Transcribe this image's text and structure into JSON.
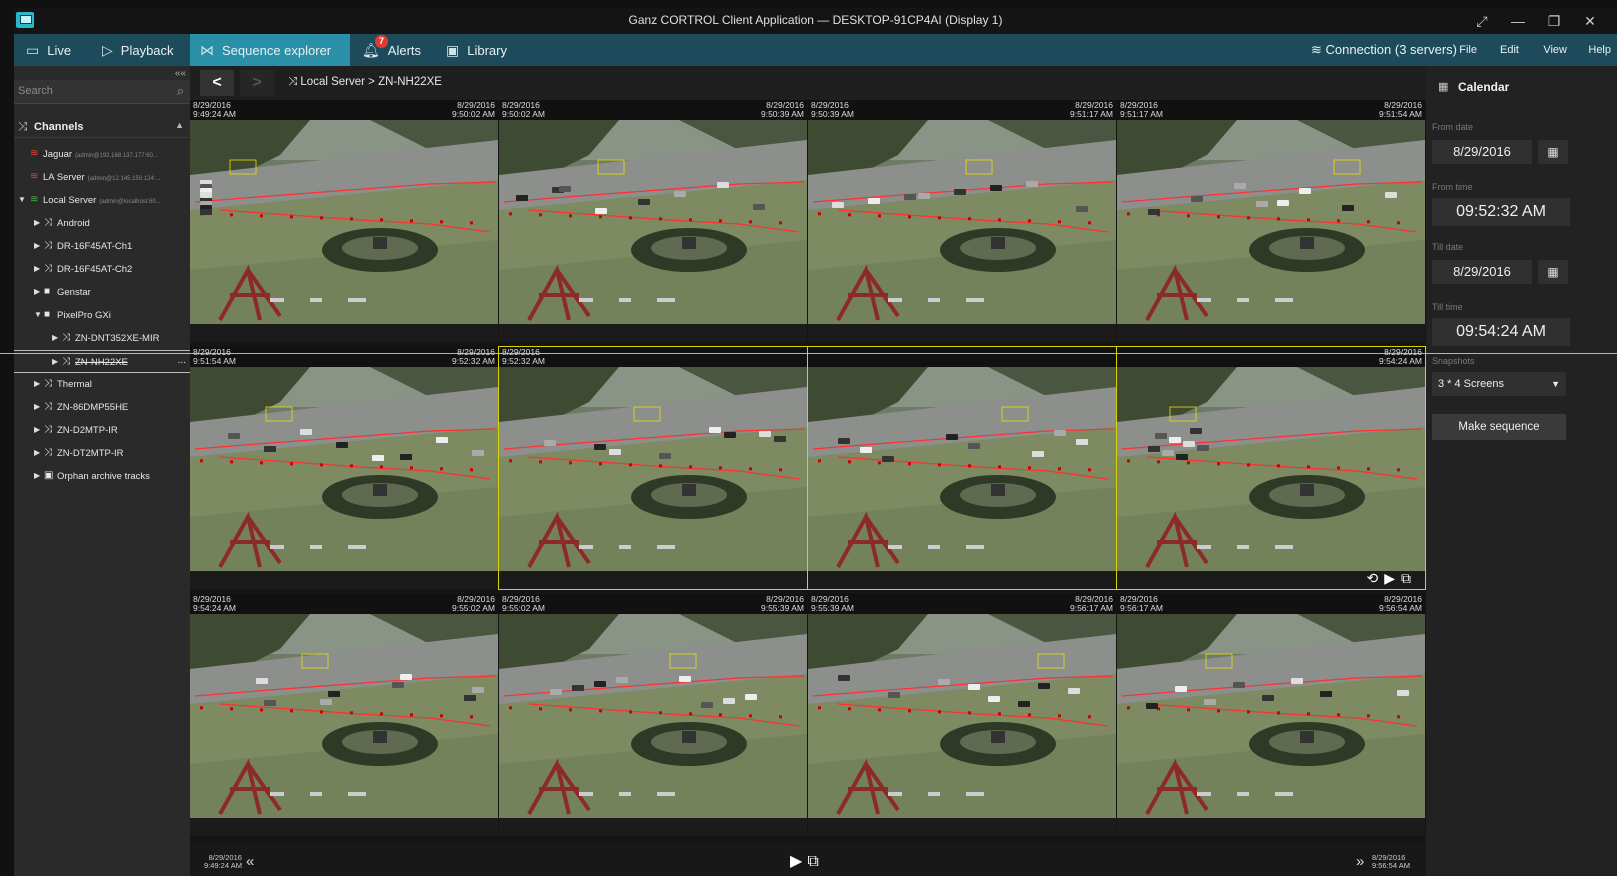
{
  "window": {
    "title": "Ganz CORTROL Client Application — DESKTOP-91CP4AI (Display 1)",
    "controls": [
      "⤢",
      "—",
      "❐",
      "✕"
    ]
  },
  "menu": {
    "tabs": [
      {
        "label": "Live",
        "icon": "monitor-icon"
      },
      {
        "label": "Playback",
        "icon": "play-outline-icon"
      },
      {
        "label": "Sequence explorer",
        "icon": "sequence-icon"
      },
      {
        "label": "Alerts",
        "icon": "bell-icon",
        "badge": "7"
      },
      {
        "label": "Library",
        "icon": "library-icon"
      }
    ],
    "connection": "Connection (3 servers)",
    "right_items": [
      "File",
      "Edit",
      "View",
      "Help"
    ]
  },
  "sidebar": {
    "collapse_glyph": "««",
    "search_placeholder": "Search",
    "channels_label": "Channels",
    "tree": [
      {
        "label": "Jaguar",
        "sub": "(admin@192.168.137.177:60...",
        "level": 0,
        "icon": "server-red-icon",
        "arrow": ""
      },
      {
        "label": "LA Server",
        "sub": "(admin@12.145.150.124:...",
        "level": 0,
        "icon": "server-red-icon",
        "arrow": ""
      },
      {
        "label": "Local Server",
        "sub": "(admin@localhost:60...",
        "level": 0,
        "icon": "server-green-icon",
        "arrow": "▼"
      },
      {
        "label": "Android",
        "sub": "",
        "level": 1,
        "icon": "channel-icon",
        "arrow": "▶"
      },
      {
        "label": "DR-16F45AT-Ch1",
        "sub": "",
        "level": 1,
        "icon": "channel-icon",
        "arrow": "▶"
      },
      {
        "label": "DR-16F45AT-Ch2",
        "sub": "",
        "level": 1,
        "icon": "channel-icon",
        "arrow": "▶"
      },
      {
        "label": "Genstar",
        "sub": "",
        "level": 1,
        "icon": "folder-icon",
        "arrow": "▶"
      },
      {
        "label": "PixelPro GXi",
        "sub": "",
        "level": 1,
        "icon": "folder-icon",
        "arrow": "▼"
      },
      {
        "label": "ZN-DNT352XE-MIR",
        "sub": "",
        "level": 2,
        "icon": "channel-icon",
        "arrow": "▶"
      },
      {
        "label": "ZN-NH22XE",
        "sub": "",
        "level": 2,
        "icon": "channel-icon",
        "arrow": "▶",
        "selected": true,
        "more": "..."
      },
      {
        "label": "Thermal",
        "sub": "",
        "level": 1,
        "icon": "channel-icon",
        "arrow": "▶"
      },
      {
        "label": "ZN-86DMP55HE",
        "sub": "",
        "level": 1,
        "icon": "channel-icon",
        "arrow": "▶"
      },
      {
        "label": "ZN-D2MTP-IR",
        "sub": "",
        "level": 1,
        "icon": "channel-icon",
        "arrow": "▶"
      },
      {
        "label": "ZN-DT2MTP-IR",
        "sub": "",
        "level": 1,
        "icon": "channel-icon",
        "arrow": "▶"
      },
      {
        "label": "Orphan archive tracks",
        "sub": "",
        "level": 1,
        "icon": "archive-icon",
        "arrow": "▶"
      }
    ]
  },
  "nav": {
    "back": "<",
    "forward": ">",
    "breadcrumb": "Local Server > ZN-NH22XE"
  },
  "cells": [
    {
      "start_date": "8/29/2016",
      "start_time": "9:49:24 AM",
      "end_date": "8/29/2016",
      "end_time": "9:50:02 AM"
    },
    {
      "start_date": "8/29/2016",
      "start_time": "9:50:02 AM",
      "end_date": "8/29/2016",
      "end_time": "9:50:39 AM"
    },
    {
      "start_date": "8/29/2016",
      "start_time": "9:50:39 AM",
      "end_date": "8/29/2016",
      "end_time": "9:51:17 AM"
    },
    {
      "start_date": "8/29/2016",
      "start_time": "9:51:17 AM",
      "end_date": "8/29/2016",
      "end_time": "9:51:54 AM"
    },
    {
      "start_date": "8/29/2016",
      "start_time": "9:51:54 AM",
      "end_date": "8/29/2016",
      "end_time": "9:52:32 AM"
    },
    {
      "start_date": "8/29/2016",
      "start_time": "9:52:32 AM",
      "end_date": "",
      "end_time": "",
      "selected": true
    },
    {
      "start_date": "",
      "start_time": "",
      "end_date": "",
      "end_time": "",
      "selected": true
    },
    {
      "start_date": "",
      "start_time": "",
      "end_date": "8/29/2016",
      "end_time": "9:54:24 AM",
      "selected": true,
      "controls": true
    },
    {
      "start_date": "8/29/2016",
      "start_time": "9:54:24 AM",
      "end_date": "8/29/2016",
      "end_time": "9:55:02 AM"
    },
    {
      "start_date": "8/29/2016",
      "start_time": "9:55:02 AM",
      "end_date": "8/29/2016",
      "end_time": "9:55:39 AM"
    },
    {
      "start_date": "8/29/2016",
      "start_time": "9:55:39 AM",
      "end_date": "8/29/2016",
      "end_time": "9:56:17 AM"
    },
    {
      "start_date": "8/29/2016",
      "start_time": "9:56:17 AM",
      "end_date": "8/29/2016",
      "end_time": "9:56:54 AM"
    }
  ],
  "cell_controls": [
    "⟲",
    "▶",
    "⧉"
  ],
  "timeline": {
    "start_date": "8/29/2016",
    "start_time": "9:49:24 AM",
    "end_date": "8/29/2016",
    "end_time": "9:56:54 AM",
    "prev": "«",
    "next": "»",
    "play": "▶",
    "frame": "⧉"
  },
  "calendar": {
    "title": "Calendar",
    "from_date_label": "From date",
    "from_date": "8/29/2016",
    "from_time_label": "From time",
    "from_time": "09:52:32 AM",
    "till_date_label": "Till date",
    "till_date": "8/29/2016",
    "till_time_label": "Till time",
    "till_time": "09:54:24 AM",
    "snapshots_label": "Snapshots",
    "snapshots_value": "3 * 4 Screens",
    "make_sequence": "Make sequence"
  },
  "colors": {
    "accent": "#2a90a8",
    "menubar": "#1e4b5c",
    "selection": "#d9d200",
    "alert_badge": "#e53935"
  }
}
